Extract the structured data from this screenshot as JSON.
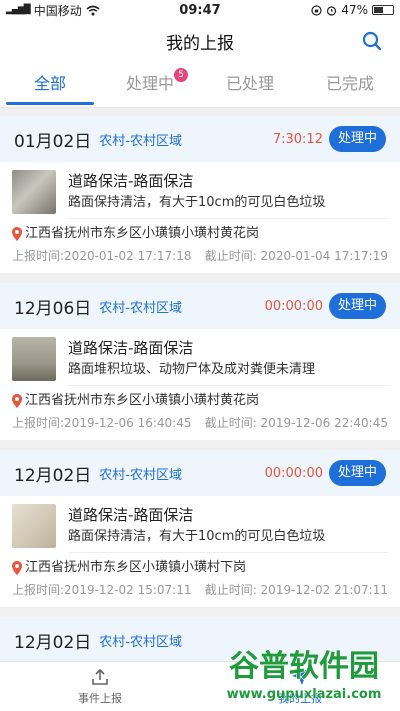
{
  "status_bar": {
    "carrier": "中国移动",
    "time": "09:47",
    "battery": "47%"
  },
  "nav": {
    "title": "我的上报"
  },
  "tabs": [
    {
      "label": "全部",
      "active": true
    },
    {
      "label": "处理中",
      "badge": "5"
    },
    {
      "label": "已处理"
    },
    {
      "label": "已完成"
    }
  ],
  "reports": [
    {
      "date": "01月02日",
      "area": "农村-农村区域",
      "timer": "7:30:12",
      "status": "处理中",
      "title": "道路保洁-路面保洁",
      "desc": "路面保持清洁，有大于10cm的可见白色垃圾",
      "address": "江西省抚州市东乡区小璜镇小璜村黄花岗",
      "reported": "上报时间:2020-01-02 17:17:18",
      "deadline": "截止时间: 2020-01-04 17:17:19"
    },
    {
      "date": "12月06日",
      "area": "农村-农村区域",
      "timer": "00:00:00",
      "status": "处理中",
      "title": "道路保洁-路面保洁",
      "desc": "路面堆积垃圾、动物尸体及成对粪便未清理",
      "address": "江西省抚州市东乡区小璜镇小璜村黄花岗",
      "reported": "上报时间:2019-12-06 16:40:45",
      "deadline": "截止时间: 2019-12-06 22:40:45"
    },
    {
      "date": "12月02日",
      "area": "农村-农村区域",
      "timer": "00:00:00",
      "status": "处理中",
      "title": "道路保洁-路面保洁",
      "desc": "路面保持清洁，有大于10cm的可见白色垃圾",
      "address": "江西省抚州市东乡区小璜镇小璜村下岗",
      "reported": "上报时间:2019-12-02 15:07:11",
      "deadline": "截止时间: 2019-12-02 21:07:11"
    },
    {
      "date": "12月02日",
      "area": "农村-农村区域",
      "timer": "",
      "status": "",
      "title": "",
      "desc": "",
      "address": "",
      "reported": "",
      "deadline": ""
    }
  ],
  "tabbar": [
    {
      "label": "事件上报",
      "icon": "upload-icon"
    },
    {
      "label": "我的上报",
      "icon": "send-icon",
      "active": true
    }
  ],
  "watermark": {
    "line1": "谷普软件园",
    "line2": "www.gupuxlazai.com"
  },
  "colors": {
    "accent": "#1e6fd9",
    "timer": "#e8543c",
    "badge": "#e9447b",
    "card_header": "#eef5fd"
  }
}
